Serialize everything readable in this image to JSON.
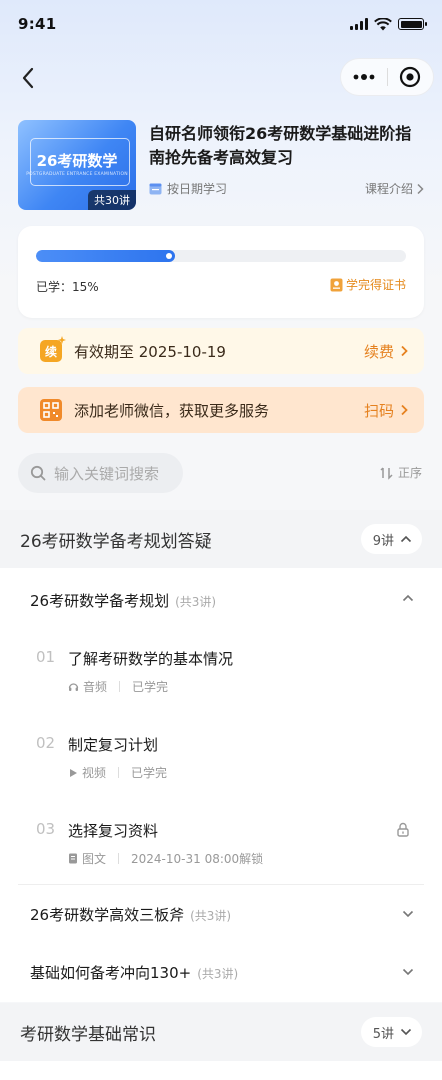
{
  "status_bar": {
    "time": "9:41"
  },
  "course": {
    "cover_title": "26考研数学",
    "cover_subtitle": "POSTGRADUATE ENTRANCE EXAMINATION",
    "cover_count": "共30讲",
    "title": "自研名师领衔26考研数学基础进阶指南抢先备考高效复习",
    "schedule": "按日期学习",
    "intro_link": "课程介绍"
  },
  "progress": {
    "percent": 15,
    "label": "已学：15%",
    "certificate": "学完得证书"
  },
  "banners": [
    {
      "icon_text": "续",
      "text": "有效期至 2025-10-19",
      "action": "续费"
    },
    {
      "text": "添加老师微信，获取更多服务",
      "action": "扫码"
    }
  ],
  "search": {
    "placeholder": "输入关键词搜索",
    "sort_label": "正序"
  },
  "sections": [
    {
      "title": "26考研数学备考规划答疑",
      "count": "9讲",
      "chapters": [
        {
          "title": "26考研数学备考规划",
          "count": "(共3讲)",
          "lessons": [
            {
              "no": "01",
              "title": "了解考研数学的基本情况",
              "type": "音频",
              "status": "已学完"
            },
            {
              "no": "02",
              "title": "制定复习计划",
              "type": "视频",
              "status": "已学完"
            },
            {
              "no": "03",
              "title": "选择复习资料",
              "type": "图文",
              "status": "2024-10-31 08:00解锁"
            }
          ]
        },
        {
          "title": "26考研数学高效三板斧",
          "count": "(共3讲)"
        },
        {
          "title": "基础如何备考冲向130+",
          "count": "(共3讲)"
        }
      ]
    },
    {
      "title": "考研数学基础常识",
      "count": "5讲"
    }
  ],
  "colors": {
    "accent": "#2d74ee",
    "orange": "#e5811f"
  }
}
